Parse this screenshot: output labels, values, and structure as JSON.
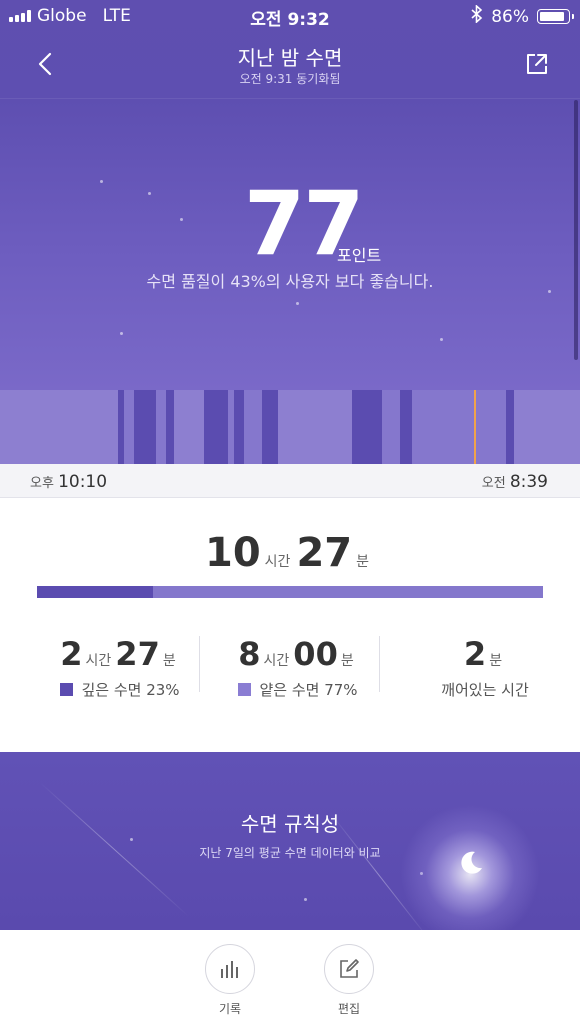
{
  "status_bar": {
    "carrier": "Globe",
    "network": "LTE",
    "time": "오전 9:32",
    "battery": "86%",
    "battery_level": 0.86
  },
  "header": {
    "title": "지난 밤 수면",
    "subtitle": "오전 9:31 동기화됨",
    "back_icon": "chevron-left-icon",
    "share_icon": "share-icon"
  },
  "score": {
    "value": "77",
    "unit": "포인트",
    "description": "수면 품질이 43%의 사용자 보다 좋습니다."
  },
  "timeline": {
    "start_prefix": "오후",
    "start_time": "10:10",
    "end_prefix": "오전",
    "end_time": "8:39"
  },
  "duration": {
    "hours": "10",
    "hours_unit": "시간",
    "minutes": "27",
    "minutes_unit": "분",
    "deep_fraction": 0.23
  },
  "stats": {
    "deep": {
      "hours": "2",
      "hours_unit": "시간",
      "minutes": "27",
      "minutes_unit": "분",
      "label": "깊은 수면 23%",
      "color": "#5b4cb0"
    },
    "light": {
      "hours": "8",
      "hours_unit": "시간",
      "minutes": "00",
      "minutes_unit": "분",
      "label": "얕은 수면 77%",
      "color": "#8a7dd3"
    },
    "awake": {
      "minutes": "2",
      "minutes_unit": "분",
      "label": "깨어있는 시간"
    }
  },
  "regularity": {
    "title": "수면 규칙성",
    "subtitle": "지난 7일의 평균 수면 데이터와 비교",
    "icon": "moon-icon"
  },
  "tabs": [
    {
      "label": "기록",
      "icon": "bar-chart-icon"
    },
    {
      "label": "편집",
      "icon": "edit-icon"
    }
  ],
  "colors": {
    "primary": "#5f4fb0",
    "deep_sleep": "#5b4cb0",
    "light_sleep": "#8a7dd3",
    "marker": "#f0a34a"
  }
}
